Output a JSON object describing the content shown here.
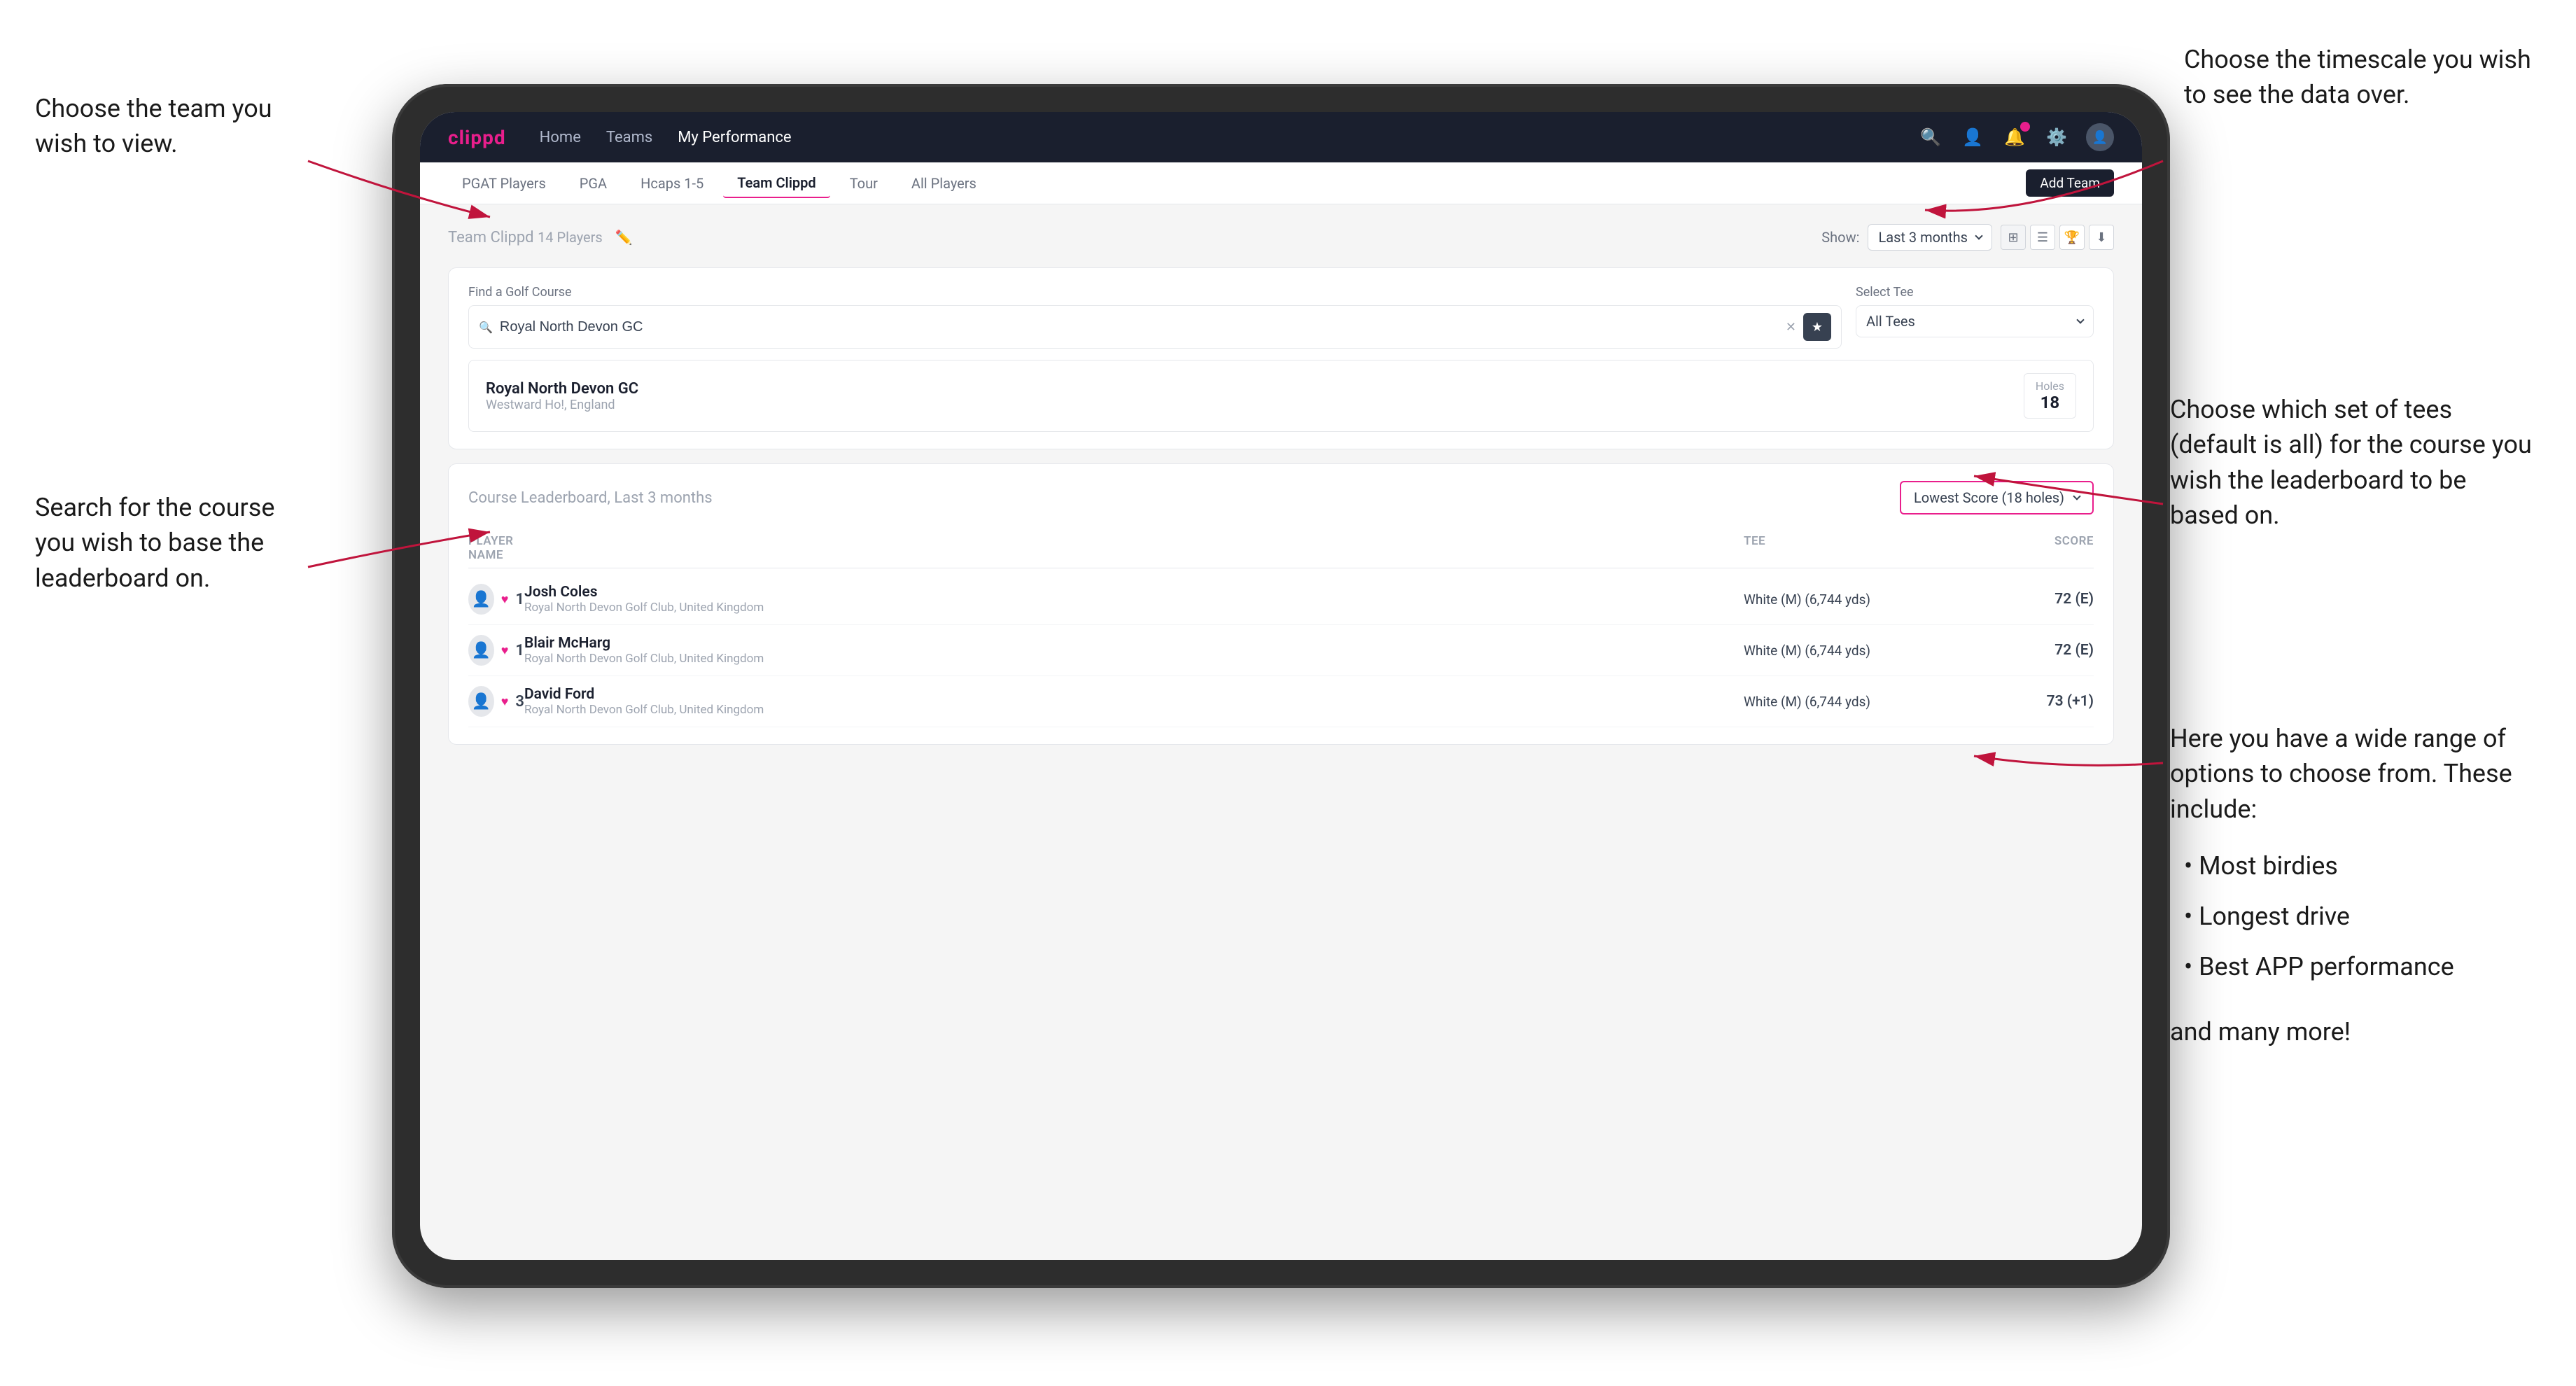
{
  "annotations": {
    "top_left": {
      "title": "Choose the team you wish to view."
    },
    "middle_left": {
      "title": "Search for the course you wish to base the leaderboard on."
    },
    "top_right": {
      "title": "Choose the timescale you wish to see the data over."
    },
    "middle_right_tee": {
      "title": "Choose which set of tees (default is all) for the course you wish the leaderboard to be based on."
    },
    "bottom_right": {
      "title": "Here you have a wide range of options to choose from. These include:",
      "bullets": [
        "Most birdies",
        "Longest drive",
        "Best APP performance"
      ],
      "footer": "and many more!"
    }
  },
  "navbar": {
    "logo": "clippd",
    "nav_items": [
      "Home",
      "Teams",
      "My Performance"
    ],
    "active_nav": "My Performance"
  },
  "sub_nav": {
    "items": [
      "PGAT Players",
      "PGA",
      "Hcaps 1-5",
      "Team Clippd",
      "Tour",
      "All Players"
    ],
    "active": "Team Clippd",
    "add_team_label": "Add Team"
  },
  "team_header": {
    "team_name": "Team Clippd",
    "player_count": "14 Players",
    "show_label": "Show:",
    "time_period": "Last 3 months"
  },
  "search_section": {
    "find_course_label": "Find a Golf Course",
    "find_course_placeholder": "Royal North Devon GC",
    "select_tee_label": "Select Tee",
    "select_tee_value": "All Tees",
    "course_result": {
      "name": "Royal North Devon GC",
      "location": "Westward Ho!, England",
      "holes_label": "Holes",
      "holes_value": "18"
    }
  },
  "leaderboard": {
    "title": "Course Leaderboard,",
    "period": "Last 3 months",
    "score_type": "Lowest Score (18 holes)",
    "columns": {
      "player_name": "PLAYER NAME",
      "tee": "TEE",
      "score": "SCORE"
    },
    "players": [
      {
        "rank": "1",
        "name": "Josh Coles",
        "club": "Royal North Devon Golf Club, United Kingdom",
        "tee": "White (M) (6,744 yds)",
        "score": "72 (E)"
      },
      {
        "rank": "1",
        "name": "Blair McHarg",
        "club": "Royal North Devon Golf Club, United Kingdom",
        "tee": "White (M) (6,744 yds)",
        "score": "72 (E)"
      },
      {
        "rank": "3",
        "name": "David Ford",
        "club": "Royal North Devon Golf Club, United Kingdom",
        "tee": "White (M) (6,744 yds)",
        "score": "73 (+1)"
      }
    ]
  },
  "colors": {
    "brand_pink": "#e91e8c",
    "navbar_bg": "#1a1f2e",
    "text_dark": "#1a1a1a",
    "text_medium": "#374151",
    "text_light": "#9ca3af"
  }
}
